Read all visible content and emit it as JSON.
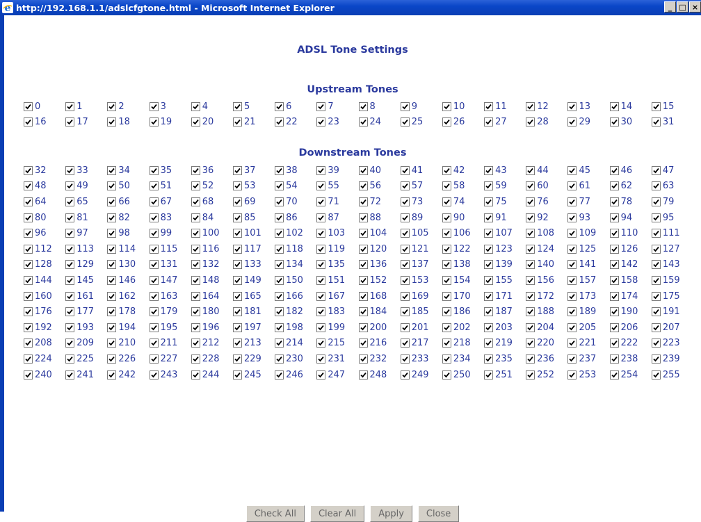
{
  "window": {
    "title": "http://192.168.1.1/adslcfgtone.html - Microsoft Internet Explorer",
    "minimize_label": "_",
    "maximize_label": "□",
    "close_label": "×"
  },
  "page": {
    "title": "ADSL Tone Settings",
    "upstream_title": "Upstream Tones",
    "downstream_title": "Downstream Tones"
  },
  "upstream_tones": [
    {
      "label": "0",
      "checked": true
    },
    {
      "label": "1",
      "checked": true
    },
    {
      "label": "2",
      "checked": true
    },
    {
      "label": "3",
      "checked": true
    },
    {
      "label": "4",
      "checked": true
    },
    {
      "label": "5",
      "checked": true
    },
    {
      "label": "6",
      "checked": true
    },
    {
      "label": "7",
      "checked": true
    },
    {
      "label": "8",
      "checked": true
    },
    {
      "label": "9",
      "checked": true
    },
    {
      "label": "10",
      "checked": true
    },
    {
      "label": "11",
      "checked": true
    },
    {
      "label": "12",
      "checked": true
    },
    {
      "label": "13",
      "checked": true
    },
    {
      "label": "14",
      "checked": true
    },
    {
      "label": "15",
      "checked": true
    },
    {
      "label": "16",
      "checked": true
    },
    {
      "label": "17",
      "checked": true
    },
    {
      "label": "18",
      "checked": true
    },
    {
      "label": "19",
      "checked": true
    },
    {
      "label": "20",
      "checked": true
    },
    {
      "label": "21",
      "checked": true
    },
    {
      "label": "22",
      "checked": true
    },
    {
      "label": "23",
      "checked": true
    },
    {
      "label": "24",
      "checked": true
    },
    {
      "label": "25",
      "checked": true
    },
    {
      "label": "26",
      "checked": true
    },
    {
      "label": "27",
      "checked": true
    },
    {
      "label": "28",
      "checked": true
    },
    {
      "label": "29",
      "checked": true
    },
    {
      "label": "30",
      "checked": true
    },
    {
      "label": "31",
      "checked": true
    }
  ],
  "downstream_tones": [
    {
      "label": "32",
      "checked": true
    },
    {
      "label": "33",
      "checked": true
    },
    {
      "label": "34",
      "checked": true
    },
    {
      "label": "35",
      "checked": true
    },
    {
      "label": "36",
      "checked": true
    },
    {
      "label": "37",
      "checked": true
    },
    {
      "label": "38",
      "checked": true
    },
    {
      "label": "39",
      "checked": true
    },
    {
      "label": "40",
      "checked": true
    },
    {
      "label": "41",
      "checked": true
    },
    {
      "label": "42",
      "checked": true
    },
    {
      "label": "43",
      "checked": true
    },
    {
      "label": "44",
      "checked": true
    },
    {
      "label": "45",
      "checked": true
    },
    {
      "label": "46",
      "checked": true
    },
    {
      "label": "47",
      "checked": true
    },
    {
      "label": "48",
      "checked": true
    },
    {
      "label": "49",
      "checked": true
    },
    {
      "label": "50",
      "checked": true
    },
    {
      "label": "51",
      "checked": true
    },
    {
      "label": "52",
      "checked": true
    },
    {
      "label": "53",
      "checked": true
    },
    {
      "label": "54",
      "checked": true
    },
    {
      "label": "55",
      "checked": true
    },
    {
      "label": "56",
      "checked": true
    },
    {
      "label": "57",
      "checked": true
    },
    {
      "label": "58",
      "checked": true
    },
    {
      "label": "59",
      "checked": true
    },
    {
      "label": "60",
      "checked": true
    },
    {
      "label": "61",
      "checked": true
    },
    {
      "label": "62",
      "checked": true
    },
    {
      "label": "63",
      "checked": true
    },
    {
      "label": "64",
      "checked": true
    },
    {
      "label": "65",
      "checked": true
    },
    {
      "label": "66",
      "checked": true
    },
    {
      "label": "67",
      "checked": true
    },
    {
      "label": "68",
      "checked": true
    },
    {
      "label": "69",
      "checked": true
    },
    {
      "label": "70",
      "checked": true
    },
    {
      "label": "71",
      "checked": true
    },
    {
      "label": "72",
      "checked": true
    },
    {
      "label": "73",
      "checked": true
    },
    {
      "label": "74",
      "checked": true
    },
    {
      "label": "75",
      "checked": true
    },
    {
      "label": "76",
      "checked": true
    },
    {
      "label": "77",
      "checked": true
    },
    {
      "label": "78",
      "checked": true
    },
    {
      "label": "79",
      "checked": true
    },
    {
      "label": "80",
      "checked": true
    },
    {
      "label": "81",
      "checked": true
    },
    {
      "label": "82",
      "checked": true
    },
    {
      "label": "83",
      "checked": true
    },
    {
      "label": "84",
      "checked": true
    },
    {
      "label": "85",
      "checked": true
    },
    {
      "label": "86",
      "checked": true
    },
    {
      "label": "87",
      "checked": true
    },
    {
      "label": "88",
      "checked": true
    },
    {
      "label": "89",
      "checked": true
    },
    {
      "label": "90",
      "checked": true
    },
    {
      "label": "91",
      "checked": true
    },
    {
      "label": "92",
      "checked": true
    },
    {
      "label": "93",
      "checked": true
    },
    {
      "label": "94",
      "checked": true
    },
    {
      "label": "95",
      "checked": true
    },
    {
      "label": "96",
      "checked": true
    },
    {
      "label": "97",
      "checked": true
    },
    {
      "label": "98",
      "checked": true
    },
    {
      "label": "99",
      "checked": true
    },
    {
      "label": "100",
      "checked": true
    },
    {
      "label": "101",
      "checked": true
    },
    {
      "label": "102",
      "checked": true
    },
    {
      "label": "103",
      "checked": true
    },
    {
      "label": "104",
      "checked": true
    },
    {
      "label": "105",
      "checked": true
    },
    {
      "label": "106",
      "checked": true
    },
    {
      "label": "107",
      "checked": true
    },
    {
      "label": "108",
      "checked": true
    },
    {
      "label": "109",
      "checked": true
    },
    {
      "label": "110",
      "checked": true
    },
    {
      "label": "111",
      "checked": true
    },
    {
      "label": "112",
      "checked": true
    },
    {
      "label": "113",
      "checked": true
    },
    {
      "label": "114",
      "checked": true
    },
    {
      "label": "115",
      "checked": true
    },
    {
      "label": "116",
      "checked": true
    },
    {
      "label": "117",
      "checked": true
    },
    {
      "label": "118",
      "checked": true
    },
    {
      "label": "119",
      "checked": true
    },
    {
      "label": "120",
      "checked": true
    },
    {
      "label": "121",
      "checked": true
    },
    {
      "label": "122",
      "checked": true
    },
    {
      "label": "123",
      "checked": true
    },
    {
      "label": "124",
      "checked": true
    },
    {
      "label": "125",
      "checked": true
    },
    {
      "label": "126",
      "checked": true
    },
    {
      "label": "127",
      "checked": true
    },
    {
      "label": "128",
      "checked": true
    },
    {
      "label": "129",
      "checked": true
    },
    {
      "label": "130",
      "checked": true
    },
    {
      "label": "131",
      "checked": true
    },
    {
      "label": "132",
      "checked": true
    },
    {
      "label": "133",
      "checked": true
    },
    {
      "label": "134",
      "checked": true
    },
    {
      "label": "135",
      "checked": true
    },
    {
      "label": "136",
      "checked": true
    },
    {
      "label": "137",
      "checked": true
    },
    {
      "label": "138",
      "checked": true
    },
    {
      "label": "139",
      "checked": true
    },
    {
      "label": "140",
      "checked": true
    },
    {
      "label": "141",
      "checked": true
    },
    {
      "label": "142",
      "checked": true
    },
    {
      "label": "143",
      "checked": true
    },
    {
      "label": "144",
      "checked": true
    },
    {
      "label": "145",
      "checked": true
    },
    {
      "label": "146",
      "checked": true
    },
    {
      "label": "147",
      "checked": true
    },
    {
      "label": "148",
      "checked": true
    },
    {
      "label": "149",
      "checked": true
    },
    {
      "label": "150",
      "checked": true
    },
    {
      "label": "151",
      "checked": true
    },
    {
      "label": "152",
      "checked": true
    },
    {
      "label": "153",
      "checked": true
    },
    {
      "label": "154",
      "checked": true
    },
    {
      "label": "155",
      "checked": true
    },
    {
      "label": "156",
      "checked": true
    },
    {
      "label": "157",
      "checked": true
    },
    {
      "label": "158",
      "checked": true
    },
    {
      "label": "159",
      "checked": true
    },
    {
      "label": "160",
      "checked": true
    },
    {
      "label": "161",
      "checked": true
    },
    {
      "label": "162",
      "checked": true
    },
    {
      "label": "163",
      "checked": true
    },
    {
      "label": "164",
      "checked": true
    },
    {
      "label": "165",
      "checked": true
    },
    {
      "label": "166",
      "checked": true
    },
    {
      "label": "167",
      "checked": true
    },
    {
      "label": "168",
      "checked": true
    },
    {
      "label": "169",
      "checked": true
    },
    {
      "label": "170",
      "checked": true
    },
    {
      "label": "171",
      "checked": true
    },
    {
      "label": "172",
      "checked": true
    },
    {
      "label": "173",
      "checked": true
    },
    {
      "label": "174",
      "checked": true
    },
    {
      "label": "175",
      "checked": true
    },
    {
      "label": "176",
      "checked": true
    },
    {
      "label": "177",
      "checked": true
    },
    {
      "label": "178",
      "checked": true
    },
    {
      "label": "179",
      "checked": true
    },
    {
      "label": "180",
      "checked": true
    },
    {
      "label": "181",
      "checked": true
    },
    {
      "label": "182",
      "checked": true
    },
    {
      "label": "183",
      "checked": true
    },
    {
      "label": "184",
      "checked": true
    },
    {
      "label": "185",
      "checked": true
    },
    {
      "label": "186",
      "checked": true
    },
    {
      "label": "187",
      "checked": true
    },
    {
      "label": "188",
      "checked": true
    },
    {
      "label": "189",
      "checked": true
    },
    {
      "label": "190",
      "checked": true
    },
    {
      "label": "191",
      "checked": true
    },
    {
      "label": "192",
      "checked": true
    },
    {
      "label": "193",
      "checked": true
    },
    {
      "label": "194",
      "checked": true
    },
    {
      "label": "195",
      "checked": true
    },
    {
      "label": "196",
      "checked": true
    },
    {
      "label": "197",
      "checked": true
    },
    {
      "label": "198",
      "checked": true
    },
    {
      "label": "199",
      "checked": true
    },
    {
      "label": "200",
      "checked": true
    },
    {
      "label": "201",
      "checked": true
    },
    {
      "label": "202",
      "checked": true
    },
    {
      "label": "203",
      "checked": true
    },
    {
      "label": "204",
      "checked": true
    },
    {
      "label": "205",
      "checked": true
    },
    {
      "label": "206",
      "checked": true
    },
    {
      "label": "207",
      "checked": true
    },
    {
      "label": "208",
      "checked": true
    },
    {
      "label": "209",
      "checked": true
    },
    {
      "label": "210",
      "checked": true
    },
    {
      "label": "211",
      "checked": true
    },
    {
      "label": "212",
      "checked": true
    },
    {
      "label": "213",
      "checked": true
    },
    {
      "label": "214",
      "checked": true
    },
    {
      "label": "215",
      "checked": true
    },
    {
      "label": "216",
      "checked": true
    },
    {
      "label": "217",
      "checked": true
    },
    {
      "label": "218",
      "checked": true
    },
    {
      "label": "219",
      "checked": true
    },
    {
      "label": "220",
      "checked": true
    },
    {
      "label": "221",
      "checked": true
    },
    {
      "label": "222",
      "checked": true
    },
    {
      "label": "223",
      "checked": true
    },
    {
      "label": "224",
      "checked": true
    },
    {
      "label": "225",
      "checked": true
    },
    {
      "label": "226",
      "checked": true
    },
    {
      "label": "227",
      "checked": true
    },
    {
      "label": "228",
      "checked": true
    },
    {
      "label": "229",
      "checked": true
    },
    {
      "label": "230",
      "checked": true
    },
    {
      "label": "231",
      "checked": true
    },
    {
      "label": "232",
      "checked": true
    },
    {
      "label": "233",
      "checked": true
    },
    {
      "label": "234",
      "checked": true
    },
    {
      "label": "235",
      "checked": true
    },
    {
      "label": "236",
      "checked": true
    },
    {
      "label": "237",
      "checked": true
    },
    {
      "label": "238",
      "checked": true
    },
    {
      "label": "239",
      "checked": true
    },
    {
      "label": "240",
      "checked": true
    },
    {
      "label": "241",
      "checked": true
    },
    {
      "label": "242",
      "checked": true
    },
    {
      "label": "243",
      "checked": true
    },
    {
      "label": "244",
      "checked": true
    },
    {
      "label": "245",
      "checked": true
    },
    {
      "label": "246",
      "checked": true
    },
    {
      "label": "247",
      "checked": true
    },
    {
      "label": "248",
      "checked": true
    },
    {
      "label": "249",
      "checked": true
    },
    {
      "label": "250",
      "checked": true
    },
    {
      "label": "251",
      "checked": true
    },
    {
      "label": "252",
      "checked": true
    },
    {
      "label": "253",
      "checked": true
    },
    {
      "label": "254",
      "checked": true
    },
    {
      "label": "255",
      "checked": true
    }
  ],
  "buttons": {
    "check_all": "Check All",
    "clear_all": "Clear All",
    "apply": "Apply",
    "close": "Close"
  },
  "colors": {
    "title_bar": "#0a46c8",
    "text_accent": "#2b3a9e",
    "button_face": "#d4d0c8"
  }
}
